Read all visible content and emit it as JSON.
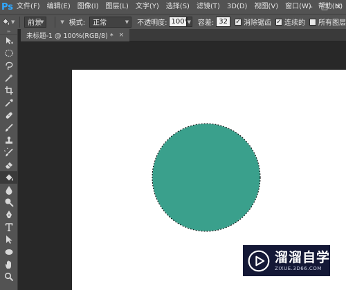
{
  "app": {
    "logo": "Ps"
  },
  "menu": {
    "items": [
      "文件(F)",
      "编辑(E)",
      "图像(I)",
      "图层(L)",
      "文字(Y)",
      "选择(S)",
      "滤镜(T)",
      "3D(D)",
      "视图(V)",
      "窗口(W)",
      "帮助(H)"
    ],
    "window_controls": [
      "–",
      "□",
      "✕"
    ]
  },
  "options": {
    "fill_source": "前景",
    "mode_label": "模式:",
    "mode_value": "正常",
    "opacity_label": "不透明度:",
    "opacity_value": "100%",
    "tolerance_label": "容差:",
    "tolerance_value": "32",
    "antialias_label": "消除锯齿",
    "antialias_checked": true,
    "contiguous_label": "连续的",
    "contiguous_checked": true,
    "all_layers_label": "所有图层",
    "all_layers_checked": false
  },
  "document": {
    "tab_title": "未标题-1 @ 100%(RGB/8) *",
    "tab_close": "×"
  },
  "tools": [
    {
      "name": "move-tool-icon",
      "active": false
    },
    {
      "name": "marquee-ellipse-tool-icon",
      "active": false
    },
    {
      "name": "lasso-tool-icon",
      "active": false
    },
    {
      "name": "magic-wand-tool-icon",
      "active": false
    },
    {
      "name": "crop-tool-icon",
      "active": false
    },
    {
      "name": "eyedropper-tool-icon",
      "active": false
    },
    {
      "name": "healing-brush-tool-icon",
      "active": false
    },
    {
      "name": "brush-tool-icon",
      "active": false
    },
    {
      "name": "clone-stamp-tool-icon",
      "active": false
    },
    {
      "name": "history-brush-tool-icon",
      "active": false
    },
    {
      "name": "eraser-tool-icon",
      "active": false
    },
    {
      "name": "paint-bucket-tool-icon",
      "active": true
    },
    {
      "name": "blur-tool-icon",
      "active": false
    },
    {
      "name": "dodge-tool-icon",
      "active": false
    },
    {
      "name": "pen-tool-icon",
      "active": false
    },
    {
      "name": "type-tool-icon",
      "active": false
    },
    {
      "name": "path-selection-tool-icon",
      "active": false
    },
    {
      "name": "ellipse-shape-tool-icon",
      "active": false
    },
    {
      "name": "hand-tool-icon",
      "active": false
    },
    {
      "name": "zoom-tool-icon",
      "active": false
    }
  ],
  "canvas": {
    "shape": "circle",
    "fill_color": "#3aa08c",
    "selection": "marching-ants"
  },
  "watermark": {
    "title": "溜溜自学",
    "subtitle": "ZIXUE.3D66.COM",
    "bg_color": "#141836"
  }
}
